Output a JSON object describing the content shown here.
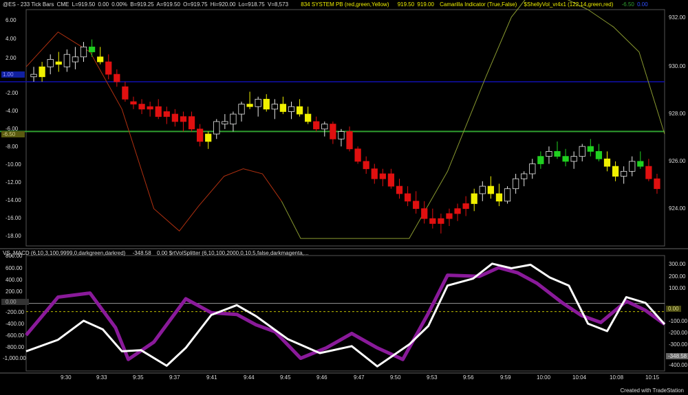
{
  "header": {
    "symbol": "@ES - 233 Tick Bars",
    "exchange": "CME",
    "last": "L=919.50",
    "change": "0.00",
    "change_pct": "0.00%",
    "bid": "B=919.25",
    "ask": "A=919.50",
    "open": "O=919.75",
    "high": "Hi=920.00",
    "low": "Lo=918.75",
    "volume": "V=8,573",
    "indicator1": "834 SYSTEM PB (red,green,Yellow)",
    "indicator1_v1": "919.50",
    "indicator1_v2": "919.00",
    "indicator2": "Camarilla Indicator (True,False)",
    "indicator3": "$ShellyVol_vr4x1 (122,14,green,red)",
    "indicator3_val": "-6.50",
    "indicator3_val2": "0.00"
  },
  "lower_header": {
    "macd": "VS_MACD (6,10,3,100,9999,0,darkgreen,darkred)",
    "macd_val": "-348.58",
    "volsplit": "0.00 $rtVolSplitter (6,10,100,2000,0,10,5,false,darkmagenta,..."
  },
  "left_axis_upper": [
    "6.00",
    "4.00",
    "2.00",
    "-2.00",
    "-4.00",
    "-6.00",
    "-8.00",
    "-10.00",
    "-12.00",
    "-14.00",
    "-16.00",
    "-18.00"
  ],
  "left_marker_upper": {
    "blue": "1.00",
    "olive": "-6.50"
  },
  "right_axis_upper": [
    "932.00",
    "930.00",
    "928.00",
    "926.00",
    "924.00"
  ],
  "left_axis_lower": [
    "800.00",
    "600.00",
    "400.00",
    "200.00",
    "0.00",
    "-200.00",
    "-400.00",
    "-600.00",
    "-800.00",
    "-1,000.00"
  ],
  "right_axis_lower": [
    "300.00",
    "200.00",
    "100.00",
    "0.00",
    "-100.00",
    "-200.00",
    "-300.00",
    "-400.00"
  ],
  "right_marker_lower": {
    "zero": "0.00",
    "value": "-348.58"
  },
  "time_axis": [
    "9:30",
    "9:33",
    "9:35",
    "9:37",
    "9:41",
    "9:44",
    "9:45",
    "9:46",
    "9:47",
    "9:50",
    "9:53",
    "9:56",
    "9:59",
    "10:00",
    "10:04",
    "10:08",
    "10:15"
  ],
  "footer": "Created with TradeStation",
  "colors": {
    "bg": "#000000",
    "red": "#e01010",
    "green": "#20d020",
    "yellow": "#f0f000",
    "blue_line": "#1010b0",
    "green_line": "#30a030",
    "macd_fill": "#8a1a9a",
    "signal": "#ffffff"
  },
  "chart_data": {
    "type": "line",
    "price_ylim": [
      923,
      932.5
    ],
    "candles": [
      [
        929.9,
        930.2,
        929.6,
        929.8,
        "w"
      ],
      [
        929.8,
        930.4,
        929.6,
        930.2,
        "y"
      ],
      [
        930.2,
        930.7,
        929.9,
        930.5,
        "w"
      ],
      [
        930.3,
        930.8,
        930.0,
        930.4,
        "y"
      ],
      [
        930.2,
        930.9,
        930.0,
        930.7,
        "w"
      ],
      [
        930.4,
        931.0,
        930.1,
        930.6,
        "w"
      ],
      [
        930.6,
        931.2,
        930.4,
        931.0,
        "w"
      ],
      [
        931.0,
        931.3,
        930.6,
        930.8,
        "g"
      ],
      [
        930.6,
        931.0,
        930.3,
        930.4,
        "y"
      ],
      [
        930.4,
        930.7,
        929.7,
        929.9,
        "r"
      ],
      [
        929.9,
        930.1,
        929.4,
        929.6,
        "r"
      ],
      [
        929.4,
        929.6,
        928.8,
        928.9,
        "r"
      ],
      [
        928.8,
        929.0,
        928.5,
        928.7,
        "r"
      ],
      [
        928.7,
        928.9,
        928.3,
        928.5,
        "r"
      ],
      [
        928.5,
        928.8,
        928.2,
        928.6,
        "r"
      ],
      [
        928.6,
        928.9,
        928.1,
        928.2,
        "r"
      ],
      [
        928.2,
        928.6,
        927.9,
        928.4,
        "r"
      ],
      [
        928.3,
        928.5,
        927.8,
        928.0,
        "r"
      ],
      [
        928.0,
        928.4,
        927.6,
        928.2,
        "r"
      ],
      [
        928.2,
        928.4,
        927.6,
        927.7,
        "r"
      ],
      [
        927.7,
        927.9,
        927.0,
        927.2,
        "r"
      ],
      [
        927.2,
        927.6,
        926.9,
        927.5,
        "y"
      ],
      [
        927.5,
        928.1,
        927.3,
        928.0,
        "w"
      ],
      [
        928.0,
        928.3,
        927.7,
        927.9,
        "w"
      ],
      [
        927.9,
        928.4,
        927.6,
        928.3,
        "w"
      ],
      [
        928.3,
        928.8,
        928.0,
        928.7,
        "w"
      ],
      [
        928.7,
        929.2,
        928.5,
        928.6,
        "y"
      ],
      [
        928.6,
        929.0,
        928.2,
        928.9,
        "w"
      ],
      [
        928.9,
        929.1,
        928.4,
        928.5,
        "y"
      ],
      [
        928.5,
        928.9,
        928.1,
        928.7,
        "w"
      ],
      [
        928.7,
        929.0,
        928.3,
        928.4,
        "y"
      ],
      [
        928.4,
        928.8,
        928.1,
        928.6,
        "w"
      ],
      [
        928.6,
        928.9,
        928.2,
        928.3,
        "y"
      ],
      [
        928.3,
        928.6,
        927.9,
        928.0,
        "y"
      ],
      [
        928.0,
        928.2,
        927.6,
        927.7,
        "r"
      ],
      [
        927.7,
        928.0,
        927.4,
        927.9,
        "w"
      ],
      [
        927.9,
        928.0,
        927.1,
        927.3,
        "r"
      ],
      [
        927.3,
        927.7,
        927.0,
        927.6,
        "w"
      ],
      [
        927.6,
        927.8,
        926.8,
        926.9,
        "r"
      ],
      [
        926.9,
        927.0,
        926.3,
        926.4,
        "r"
      ],
      [
        926.4,
        926.6,
        925.9,
        926.1,
        "r"
      ],
      [
        926.1,
        926.3,
        925.5,
        925.7,
        "r"
      ],
      [
        925.7,
        926.1,
        925.4,
        925.9,
        "r"
      ],
      [
        925.9,
        926.1,
        925.3,
        925.4,
        "r"
      ],
      [
        925.4,
        925.7,
        924.9,
        925.1,
        "r"
      ],
      [
        925.1,
        925.4,
        924.6,
        924.8,
        "r"
      ],
      [
        924.8,
        925.2,
        924.3,
        924.5,
        "r"
      ],
      [
        924.5,
        924.8,
        923.9,
        924.1,
        "r"
      ],
      [
        924.1,
        924.5,
        923.7,
        923.9,
        "r"
      ],
      [
        923.9,
        924.3,
        923.5,
        924.1,
        "r"
      ],
      [
        924.1,
        924.5,
        923.8,
        924.3,
        "r"
      ],
      [
        924.3,
        924.7,
        924.0,
        924.5,
        "r"
      ],
      [
        924.5,
        925.0,
        924.2,
        924.7,
        "r"
      ],
      [
        924.7,
        925.3,
        924.4,
        925.1,
        "y"
      ],
      [
        925.1,
        925.6,
        924.8,
        925.4,
        "w"
      ],
      [
        925.4,
        925.8,
        924.9,
        925.1,
        "y"
      ],
      [
        925.1,
        925.5,
        924.6,
        924.8,
        "y"
      ],
      [
        924.8,
        925.4,
        924.7,
        925.3,
        "w"
      ],
      [
        925.3,
        925.9,
        925.1,
        925.7,
        "w"
      ],
      [
        925.7,
        926.0,
        925.4,
        925.9,
        "w"
      ],
      [
        925.9,
        926.5,
        925.7,
        926.3,
        "w"
      ],
      [
        926.3,
        926.8,
        926.1,
        926.6,
        "g"
      ],
      [
        926.6,
        927.0,
        926.3,
        926.8,
        "w"
      ],
      [
        926.8,
        927.2,
        926.5,
        926.6,
        "g"
      ],
      [
        926.6,
        926.9,
        926.2,
        926.4,
        "g"
      ],
      [
        926.4,
        926.8,
        926.1,
        926.6,
        "w"
      ],
      [
        926.6,
        927.1,
        926.4,
        927.0,
        "w"
      ],
      [
        927.0,
        927.3,
        926.6,
        926.8,
        "g"
      ],
      [
        926.8,
        927.1,
        926.4,
        926.5,
        "g"
      ],
      [
        926.5,
        926.8,
        926.0,
        926.2,
        "y"
      ],
      [
        926.2,
        926.4,
        925.6,
        925.8,
        "y"
      ],
      [
        925.8,
        926.2,
        925.5,
        926.0,
        "w"
      ],
      [
        926.0,
        926.6,
        925.8,
        926.4,
        "w"
      ],
      [
        926.4,
        926.8,
        926.1,
        926.2,
        "g"
      ],
      [
        926.2,
        926.5,
        925.6,
        925.7,
        "r"
      ],
      [
        925.7,
        925.9,
        925.1,
        925.3,
        "r"
      ]
    ],
    "blue_hline": 929.6,
    "green_hline": 927.6,
    "shelly_line": [
      [
        0,
        930.2
      ],
      [
        0.05,
        931.6
      ],
      [
        0.1,
        930.8
      ],
      [
        0.15,
        928.5
      ],
      [
        0.2,
        924.5
      ],
      [
        0.24,
        923.6
      ],
      [
        0.27,
        924.6
      ],
      [
        0.31,
        925.8
      ],
      [
        0.34,
        926.1
      ],
      [
        0.37,
        925.9
      ],
      [
        0.4,
        924.8
      ],
      [
        0.43,
        923.3
      ],
      [
        0.6,
        923.3
      ],
      [
        0.66,
        926.0
      ],
      [
        0.72,
        929.8
      ],
      [
        0.76,
        932.2
      ],
      [
        0.8,
        933.5
      ],
      [
        0.88,
        932.5
      ],
      [
        0.92,
        931.8
      ],
      [
        0.96,
        930.8
      ],
      [
        1.0,
        927.5
      ]
    ],
    "macd_ylim": [
      -1100,
      900
    ],
    "macd": [
      [
        0,
        -480
      ],
      [
        0.05,
        180
      ],
      [
        0.1,
        250
      ],
      [
        0.14,
        -350
      ],
      [
        0.16,
        -900
      ],
      [
        0.2,
        -600
      ],
      [
        0.25,
        150
      ],
      [
        0.29,
        -90
      ],
      [
        0.33,
        -120
      ],
      [
        0.36,
        -300
      ],
      [
        0.39,
        -420
      ],
      [
        0.43,
        -880
      ],
      [
        0.47,
        -700
      ],
      [
        0.51,
        -450
      ],
      [
        0.55,
        -700
      ],
      [
        0.59,
        -900
      ],
      [
        0.63,
        -100
      ],
      [
        0.66,
        560
      ],
      [
        0.71,
        540
      ],
      [
        0.74,
        690
      ],
      [
        0.77,
        600
      ],
      [
        0.8,
        420
      ],
      [
        0.84,
        80
      ],
      [
        0.87,
        -140
      ],
      [
        0.9,
        -260
      ],
      [
        0.94,
        110
      ],
      [
        0.97,
        -50
      ],
      [
        1.0,
        -290
      ]
    ],
    "signal": [
      [
        0,
        -760
      ],
      [
        0.05,
        -560
      ],
      [
        0.09,
        -230
      ],
      [
        0.12,
        -380
      ],
      [
        0.15,
        -760
      ],
      [
        0.18,
        -740
      ],
      [
        0.22,
        -1010
      ],
      [
        0.25,
        -700
      ],
      [
        0.29,
        -130
      ],
      [
        0.33,
        40
      ],
      [
        0.36,
        -150
      ],
      [
        0.41,
        -550
      ],
      [
        0.46,
        -790
      ],
      [
        0.51,
        -670
      ],
      [
        0.55,
        -1020
      ],
      [
        0.6,
        -640
      ],
      [
        0.63,
        -320
      ],
      [
        0.66,
        380
      ],
      [
        0.7,
        500
      ],
      [
        0.73,
        760
      ],
      [
        0.76,
        680
      ],
      [
        0.79,
        740
      ],
      [
        0.82,
        520
      ],
      [
        0.85,
        380
      ],
      [
        0.88,
        -280
      ],
      [
        0.91,
        -410
      ],
      [
        0.94,
        180
      ],
      [
        0.97,
        80
      ],
      [
        1.0,
        -290
      ]
    ]
  }
}
